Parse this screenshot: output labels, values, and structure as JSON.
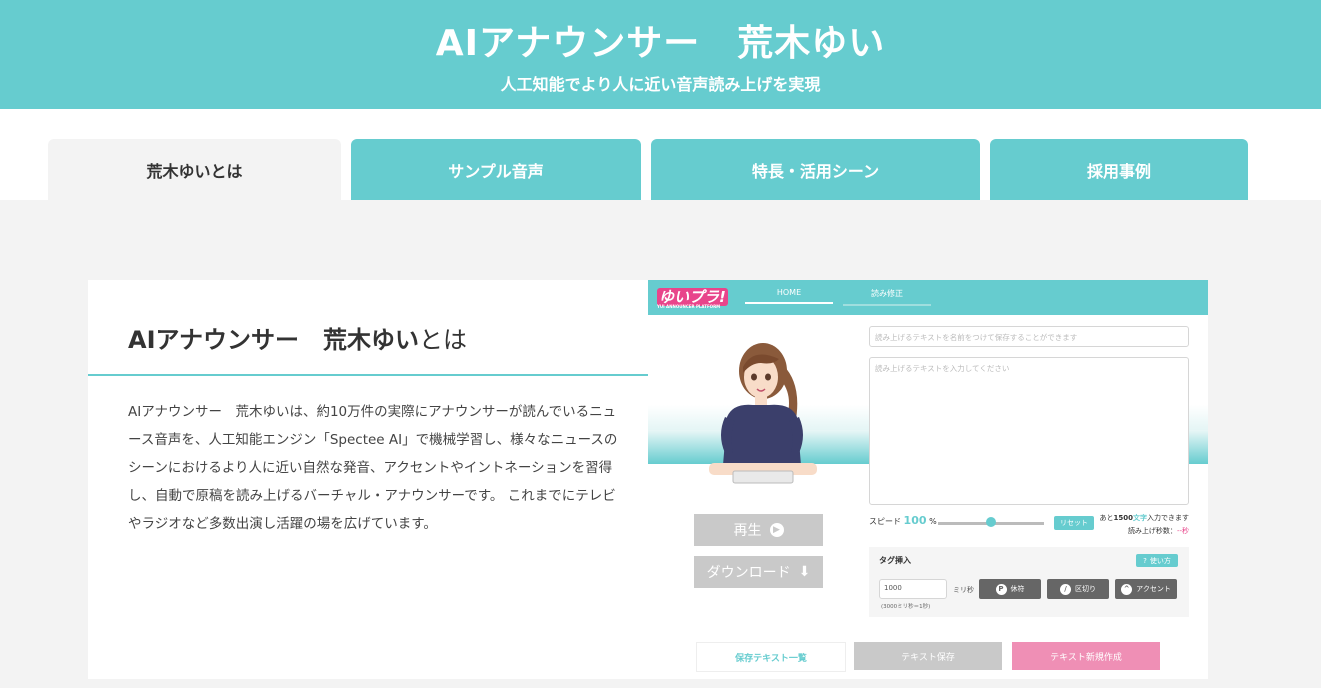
{
  "hero": {
    "title": "AIアナウンサー　荒木ゆい",
    "subtitle": "人工知能でより人に近い音声読み上げを実現"
  },
  "tabs": [
    {
      "label": "荒木ゆいとは",
      "active": true
    },
    {
      "label": "サンプル音声",
      "active": false
    },
    {
      "label": "特長・活用シーン",
      "active": false
    },
    {
      "label": "採用事例",
      "active": false
    }
  ],
  "section": {
    "heading_bold": "AIアナウンサー　荒木ゆい",
    "heading_thin": "とは",
    "body": "AIアナウンサー　荒木ゆいは、約10万件の実際にアナウンサーが読んでいるニュース音声を、人工知能エンジン「Spectee AI」で機械学習し、様々なニュースのシーンにおけるより人に近い自然な発音、アクセントやイントネーションを習得し、自動で原稿を読み上げるバーチャル・アナウンサーです。 これまでにテレビやラジオなど多数出演し活躍の場を広げています。"
  },
  "app": {
    "logo": "ゆいプラ!",
    "logo_sub": "YUI ANNOUNCER PLATFORM",
    "nav": [
      "HOME",
      "読み修正"
    ],
    "title_placeholder": "読み上げるテキストを名前をつけて保存することができます",
    "text_placeholder": "読み上げるテキストを入力してください",
    "play_label": "再生",
    "download_label": "ダウンロード",
    "speed_label": "スピード",
    "speed_value": "100",
    "speed_unit": "%",
    "speed_level": 0.5,
    "reset_label": "リセット",
    "remaining_prefix": "あと",
    "remaining_count": "1500",
    "remaining_unit": "文字",
    "remaining_suffix": "入力できます",
    "read_seconds_label": "読み上げ秒数：",
    "read_seconds_value": "--秒",
    "tag_title": "タグ挿入",
    "howto_label": "使い方",
    "ms_value": "1000",
    "ms_unit": "ミリ秒",
    "ms_hint": "(3000ミリ秒＝1秒)",
    "tag_buttons": [
      {
        "icon": "P",
        "label": "休符"
      },
      {
        "icon": "/",
        "label": "区切り"
      },
      {
        "icon": "^",
        "label": "アクセント"
      }
    ],
    "bottom_buttons": [
      "保存テキスト一覧",
      "テキスト保存",
      "テキスト新規作成"
    ],
    "colors": {
      "accent": "#66cccf",
      "pink": "#e8458b",
      "grey": "#c9c9c9"
    }
  }
}
